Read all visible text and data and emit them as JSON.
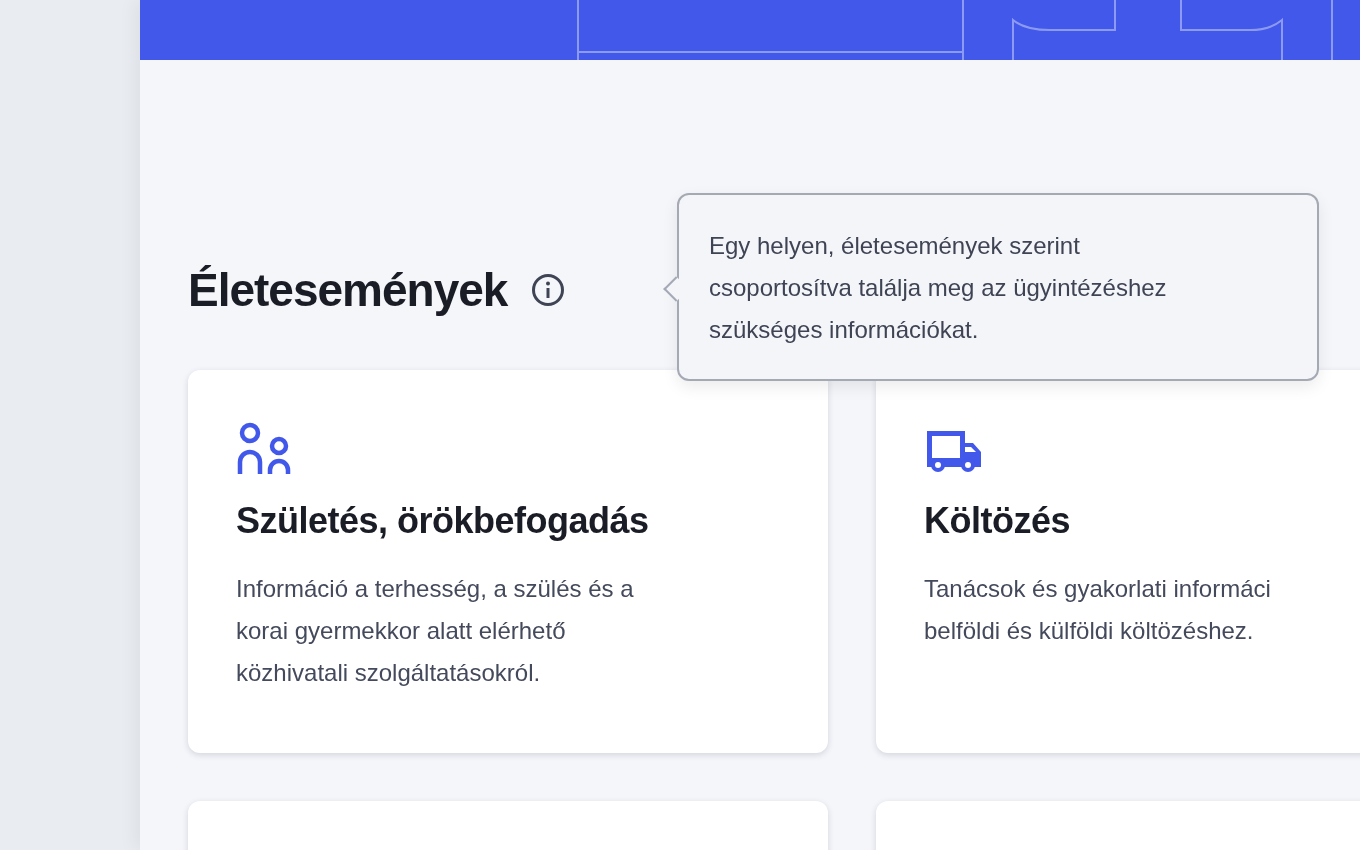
{
  "section": {
    "title": "Életesemények",
    "tooltip": "Egy helyen, életesemények szerint csoportosítva találja meg az ügyintézéshez szükséges információkat."
  },
  "cards": [
    {
      "kind": "family",
      "title": "Születés, örökbefogadás",
      "description_lines": [
        "Információ a terhesség, a szülés és a",
        "korai gyermekkor alatt elérhető",
        "közhivatali szolgáltatásokról."
      ]
    },
    {
      "kind": "truck",
      "title": "Költözés",
      "description_lines": [
        "Tanácsok és gyakorlati informáci",
        "belföldi és külföldi költözéshez."
      ]
    },
    {
      "kind": "blank"
    },
    {
      "kind": "blank"
    }
  ]
}
